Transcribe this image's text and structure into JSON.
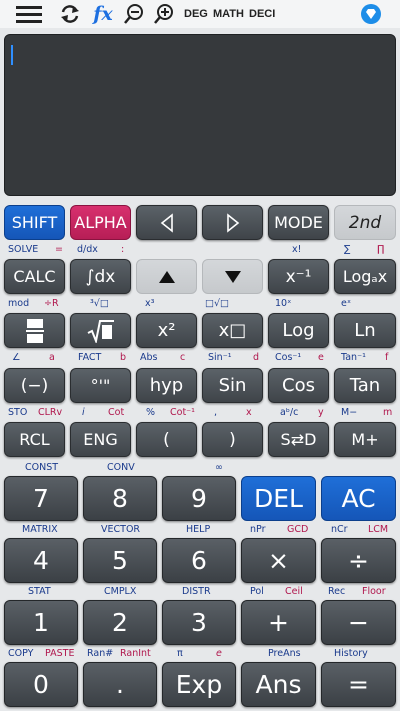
{
  "topbar": {
    "deg_label": "DEG",
    "math_label": "MATH",
    "deci_label": "DECI",
    "fx_label": "fx"
  },
  "colors": {
    "accent_blue": "#1f6fd8",
    "alpha_pink": "#d8306e",
    "display_bg": "#36393c"
  },
  "rows": {
    "r1": {
      "shift": "SHIFT",
      "alpha": "ALPHA",
      "mode": "MODE",
      "second": "2nd"
    },
    "r1_sub": {
      "solve": "SOLVE",
      "eq": "=",
      "ddx": "d/dx",
      "colon": ":",
      "xfact": "x!",
      "sum": "∑",
      "prod": "∏"
    },
    "r2": {
      "calc": "CALC",
      "integral": "∫dx",
      "xinv": "x⁻¹",
      "logax": "Logₐx"
    },
    "r2_sub": {
      "mod": "mod",
      "divr": "÷R",
      "cbrt": "³√□",
      "x3": "x³",
      "nroot": "□√□",
      "tenx": "10ˣ",
      "ex": "eˣ"
    },
    "r3": {
      "x2": "x²",
      "xpow": "x□",
      "log": "Log",
      "ln": "Ln"
    },
    "r3_sub": {
      "angle": "∠",
      "a": "a",
      "fact": "FACT",
      "b": "b",
      "abs": "Abs",
      "c": "c",
      "asin": "Sin⁻¹",
      "d": "d",
      "acos": "Cos⁻¹",
      "e": "e",
      "atan": "Tan⁻¹",
      "f": "f"
    },
    "r4": {
      "neg": "(−)",
      "deg": "°'\"",
      "hyp": "hyp",
      "sin": "Sin",
      "cos": "Cos",
      "tan": "Tan"
    },
    "r4_sub": {
      "sto": "STO",
      "clrv": "CLRv",
      "i": "i",
      "cot": "Cot",
      "pct": "%",
      "acot": "Cot⁻¹",
      "comma": ",",
      "x": "x",
      "abc": "aᵇ/c",
      "y": "y",
      "mminus": "M−",
      "m": "m"
    },
    "r5": {
      "rcl": "RCL",
      "eng": "ENG",
      "lparen": "(",
      "rparen": ")",
      "sd": "S⇄D",
      "mplus": "M+"
    },
    "r5_sub": {
      "const": "CONST",
      "conv": "CONV",
      "inf": "∞"
    },
    "r6": {
      "seven": "7",
      "eight": "8",
      "nine": "9",
      "del": "DEL",
      "ac": "AC"
    },
    "r6_sub": {
      "matrix": "MATRIX",
      "vector": "VECTOR",
      "help": "HELP",
      "npr": "nPr",
      "gcd": "GCD",
      "ncr": "nCr",
      "lcm": "LCM"
    },
    "r7": {
      "four": "4",
      "five": "5",
      "six": "6",
      "mul": "×",
      "div": "÷"
    },
    "r7_sub": {
      "stat": "STAT",
      "cmplx": "CMPLX",
      "distr": "DISTR",
      "pol": "Pol",
      "ceil": "Ceil",
      "rec": "Rec",
      "floor": "Floor"
    },
    "r8": {
      "one": "1",
      "two": "2",
      "three": "3",
      "plus": "+",
      "minus": "−"
    },
    "r8_sub": {
      "copy": "COPY",
      "paste": "PASTE",
      "ran": "Ran#",
      "ranint": "RanInt",
      "pi": "π",
      "e": "e",
      "preans": "PreAns",
      "history": "History"
    },
    "r9": {
      "zero": "0",
      "dot": ".",
      "exp": "Exp",
      "ans": "Ans",
      "eq": "="
    }
  }
}
